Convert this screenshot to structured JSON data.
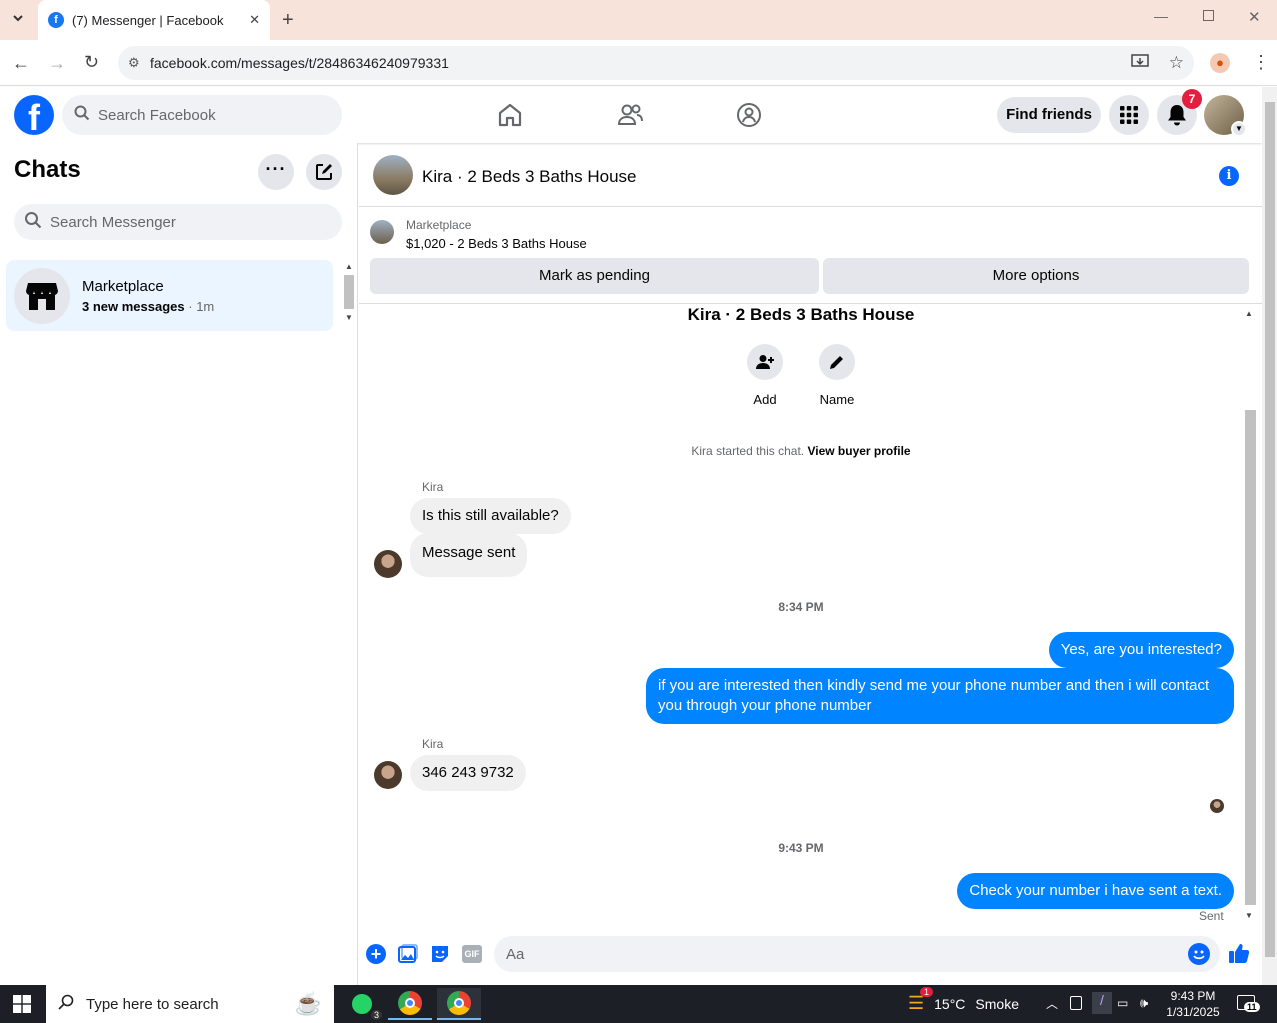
{
  "browser": {
    "tab_title": "(7) Messenger | Facebook",
    "url": "facebook.com/messages/t/28486346240979331"
  },
  "fb": {
    "search_placeholder": "Search Facebook",
    "find_friends": "Find friends",
    "notif_count": "7"
  },
  "sidebar": {
    "title": "Chats",
    "search_placeholder": "Search Messenger",
    "chats": [
      {
        "name": "Marketplace",
        "preview": "3 new messages",
        "time": "1m"
      }
    ]
  },
  "conversation": {
    "title": "Kira · 2 Beds 3 Baths House",
    "listing_label": "Marketplace",
    "listing_price": "$1,020 - 2 Beds 3 Baths House",
    "mark_pending": "Mark as pending",
    "more_options": "More options",
    "chat_heading": "Kira · 2 Beds 3 Baths House",
    "add_label": "Add",
    "name_label": "Name",
    "started_text": "Kira started this chat.",
    "buyer_profile": "View buyer profile",
    "sender_name": "Kira",
    "messages": {
      "in1": "Is this still available?",
      "in2": "Message sent",
      "time1": "8:34 PM",
      "out1": "Yes, are you interested?",
      "out2": "if you are interested then kindly send me your phone number and then i will contact you through your phone number",
      "in3": "346 243 9732",
      "time2": "9:43 PM",
      "out3": "Check your number i have sent a text.",
      "status": "Sent"
    },
    "composer_placeholder": "Aa"
  },
  "taskbar": {
    "search_placeholder": "Type here to search",
    "whatsapp_badge": "3",
    "weather_badge": "1",
    "temperature": "15°C",
    "weather": "Smoke",
    "time": "9:43 PM",
    "date": "1/31/2025",
    "notif_count": "11"
  },
  "colors": {
    "fb_blue": "#0866ff",
    "out_bubble": "#0084ff",
    "in_bubble": "#f0f0f0",
    "selected_chat": "#ebf5ff"
  }
}
